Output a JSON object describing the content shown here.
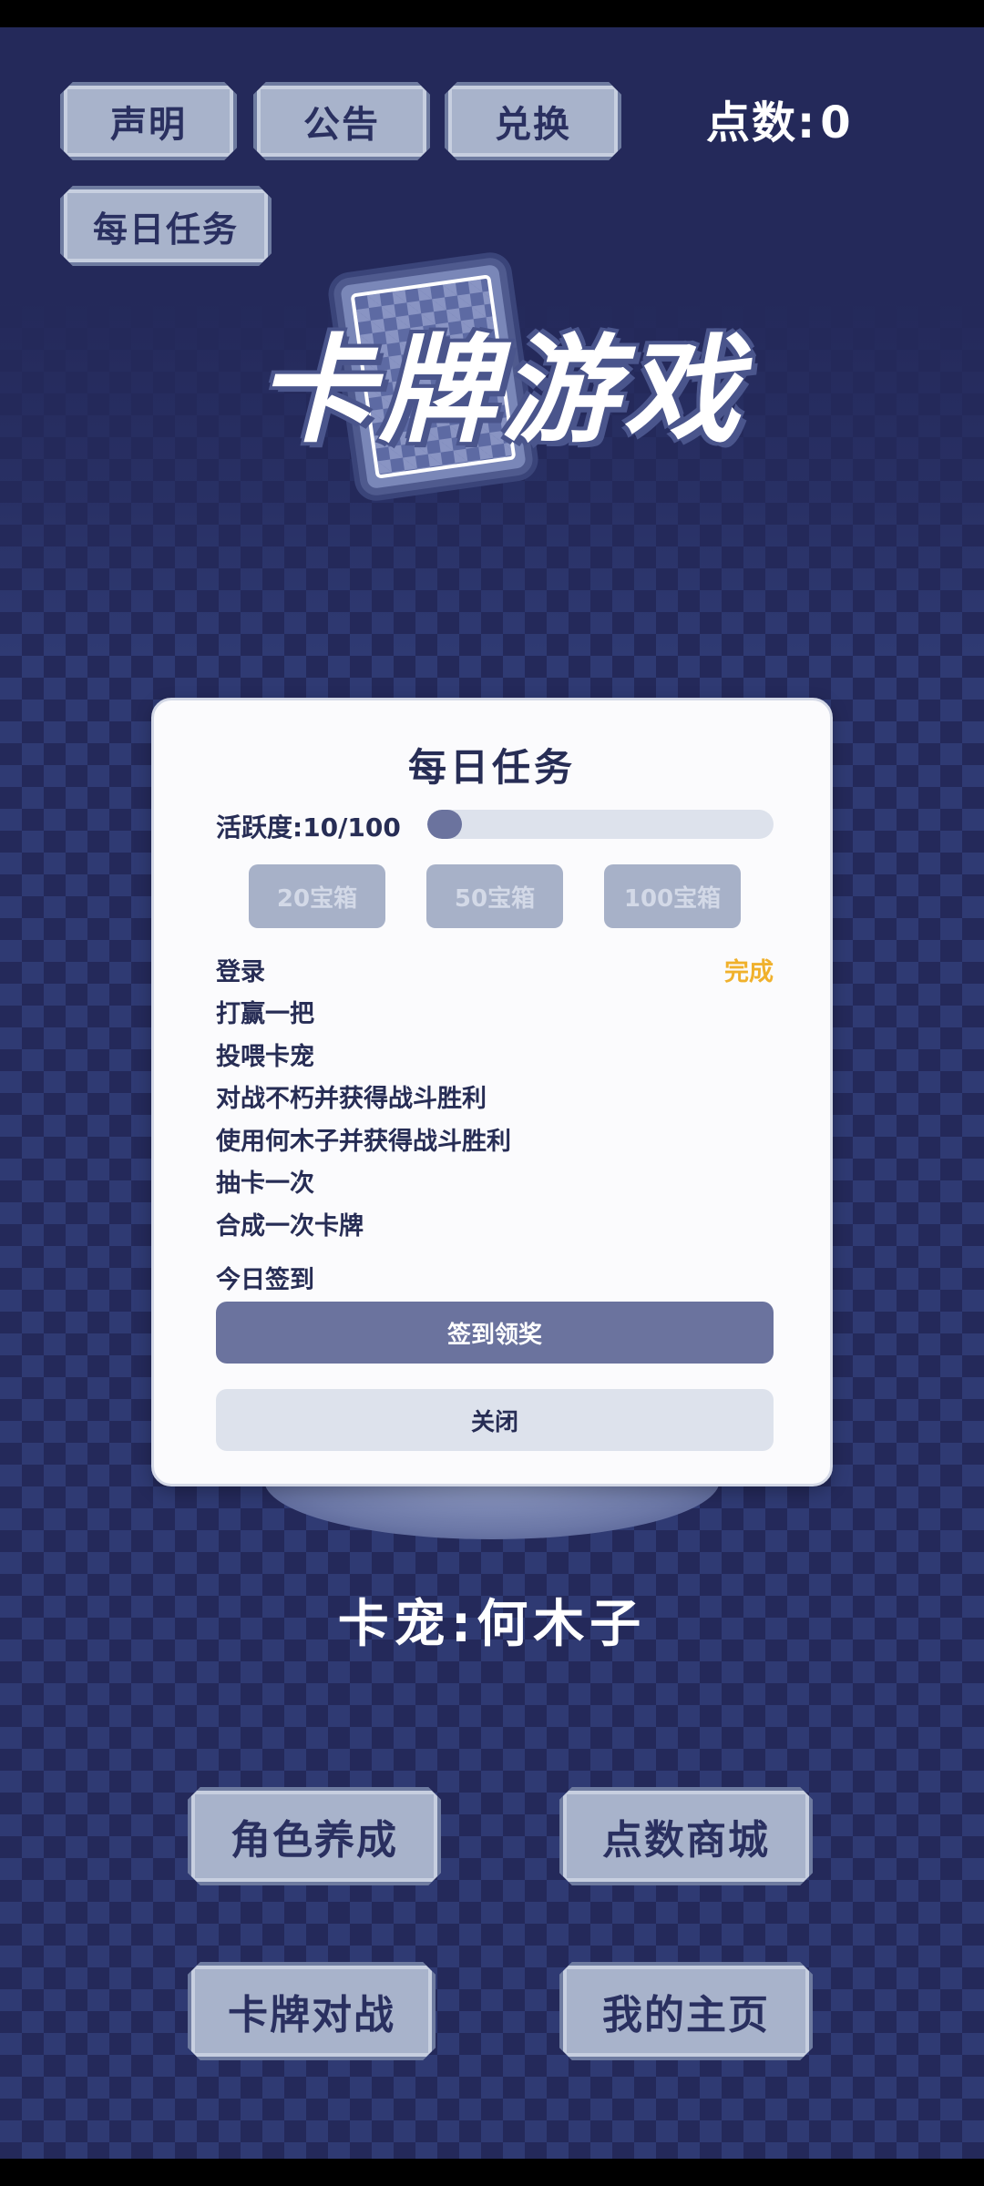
{
  "header": {
    "statement_label": "声明",
    "notice_label": "公告",
    "redeem_label": "兑换",
    "daily_tasks_label": "每日任务",
    "points_label": "点数:",
    "points_value": "0"
  },
  "logo": {
    "title": "卡牌游戏"
  },
  "modal": {
    "title": "每日任务",
    "activity_label": "活跃度:",
    "activity_value": "10/100",
    "activity_progress": 0.1,
    "chests": [
      "20宝箱",
      "50宝箱",
      "100宝箱"
    ],
    "tasks": [
      {
        "name": "登录",
        "status": "完成"
      },
      {
        "name": "打赢一把",
        "status": ""
      },
      {
        "name": "投喂卡宠",
        "status": ""
      },
      {
        "name": "对战不朽并获得战斗胜利",
        "status": ""
      },
      {
        "name": "使用何木子并获得战斗胜利",
        "status": ""
      },
      {
        "name": "抽卡一次",
        "status": ""
      },
      {
        "name": "合成一次卡牌",
        "status": ""
      }
    ],
    "signin_label": "今日签到",
    "signin_button": "签到领奖",
    "close_button": "关闭"
  },
  "pet": {
    "label": "卡宠:何木子"
  },
  "menu": {
    "character_label": "角色养成",
    "shop_label": "点数商城",
    "battle_label": "卡牌对战",
    "home_label": "我的主页"
  },
  "colors": {
    "background": "#24295a",
    "checker": "#2f3a73",
    "button_stone": "#a8b3cb",
    "accent": "#6b739e",
    "complete": "#f0b12c"
  }
}
